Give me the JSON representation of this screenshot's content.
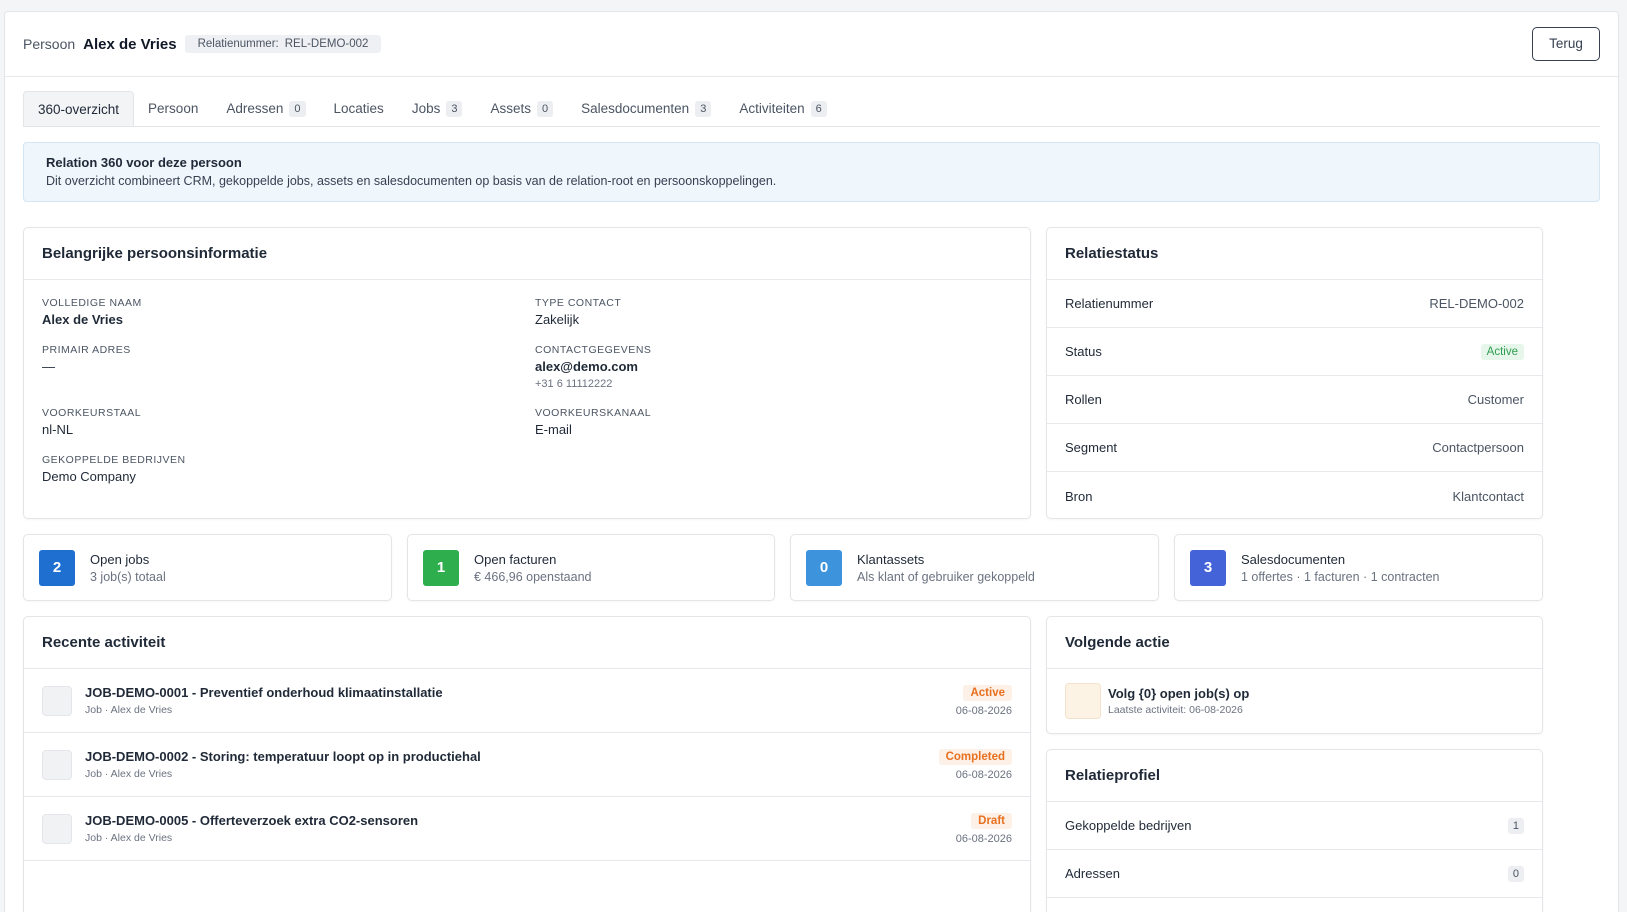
{
  "header": {
    "type_label": "Persoon",
    "name": "Alex de Vries",
    "relation_label": "Relatienummer:",
    "relation_number": "REL-DEMO-002",
    "back_label": "Terug"
  },
  "tabs": [
    {
      "label": "360-overzicht",
      "count": null,
      "active": true
    },
    {
      "label": "Persoon",
      "count": null
    },
    {
      "label": "Adressen",
      "count": "0"
    },
    {
      "label": "Locaties",
      "count": null
    },
    {
      "label": "Jobs",
      "count": "3"
    },
    {
      "label": "Assets",
      "count": "0"
    },
    {
      "label": "Salesdocumenten",
      "count": "3"
    },
    {
      "label": "Activiteiten",
      "count": "6"
    }
  ],
  "info": {
    "title": "Relation 360 voor deze persoon",
    "description": "Dit overzicht combineert CRM, gekoppelde jobs, assets en salesdocumenten op basis van de relation-root en persoonskoppelingen."
  },
  "person_info": {
    "title": "Belangrijke persoonsinformatie",
    "full_name_label": "Volledige naam",
    "full_name": "Alex de Vries",
    "contact_type_label": "Type contact",
    "contact_type": "Zakelijk",
    "primary_address_label": "Primair adres",
    "primary_address": "—",
    "contact_label": "Contactgegevens",
    "email": "alex@demo.com",
    "phone": "+31 6 11112222",
    "language_label": "Voorkeurstaal",
    "language": "nl-NL",
    "channel_label": "Voorkeurskanaal",
    "channel": "E-mail",
    "companies_label": "Gekoppelde bedrijven",
    "companies": "Demo Company"
  },
  "relation_status": {
    "title": "Relatiestatus",
    "rows": {
      "number_label": "Relatienummer",
      "number": "REL-DEMO-002",
      "status_label": "Status",
      "status": "Active",
      "roles_label": "Rollen",
      "roles": "Customer",
      "segment_label": "Segment",
      "segment": "Contactpersoon",
      "source_label": "Bron",
      "source": "Klantcontact"
    }
  },
  "stats": [
    {
      "value": "2",
      "title": "Open jobs",
      "sub": "3 job(s) totaal",
      "color": "#1f6fd1"
    },
    {
      "value": "1",
      "title": "Open facturen",
      "sub": "€ 466,96 openstaand",
      "color": "#2fae4e"
    },
    {
      "value": "0",
      "title": "Klantassets",
      "sub": "Als klant of gebruiker gekoppeld",
      "color": "#3d93dc"
    },
    {
      "value": "3",
      "title": "Salesdocumenten",
      "sub": "1 offertes · 1 facturen · 1 contracten",
      "color": "#4563d8"
    }
  ],
  "recent": {
    "title": "Recente activiteit",
    "items": [
      {
        "title": "JOB-DEMO-0001 - Preventief onderhoud klimaatinstallatie",
        "sub": "Job · Alex de Vries",
        "status": "Active",
        "date": "06-08-2026"
      },
      {
        "title": "JOB-DEMO-0002 - Storing: temperatuur loopt op in productiehal",
        "sub": "Job · Alex de Vries",
        "status": "Completed",
        "date": "06-08-2026"
      },
      {
        "title": "JOB-DEMO-0005 - Offerteverzoek extra CO2-sensoren",
        "sub": "Job · Alex de Vries",
        "status": "Draft",
        "date": "06-08-2026"
      }
    ]
  },
  "next_action": {
    "title": "Volgende actie",
    "text": "Volg {0} open job(s) op",
    "sub": "Laatste activiteit: 06-08-2026"
  },
  "profile": {
    "title": "Relatieprofiel",
    "rows": [
      {
        "label": "Gekoppelde bedrijven",
        "count": "1"
      },
      {
        "label": "Adressen",
        "count": "0"
      }
    ]
  }
}
